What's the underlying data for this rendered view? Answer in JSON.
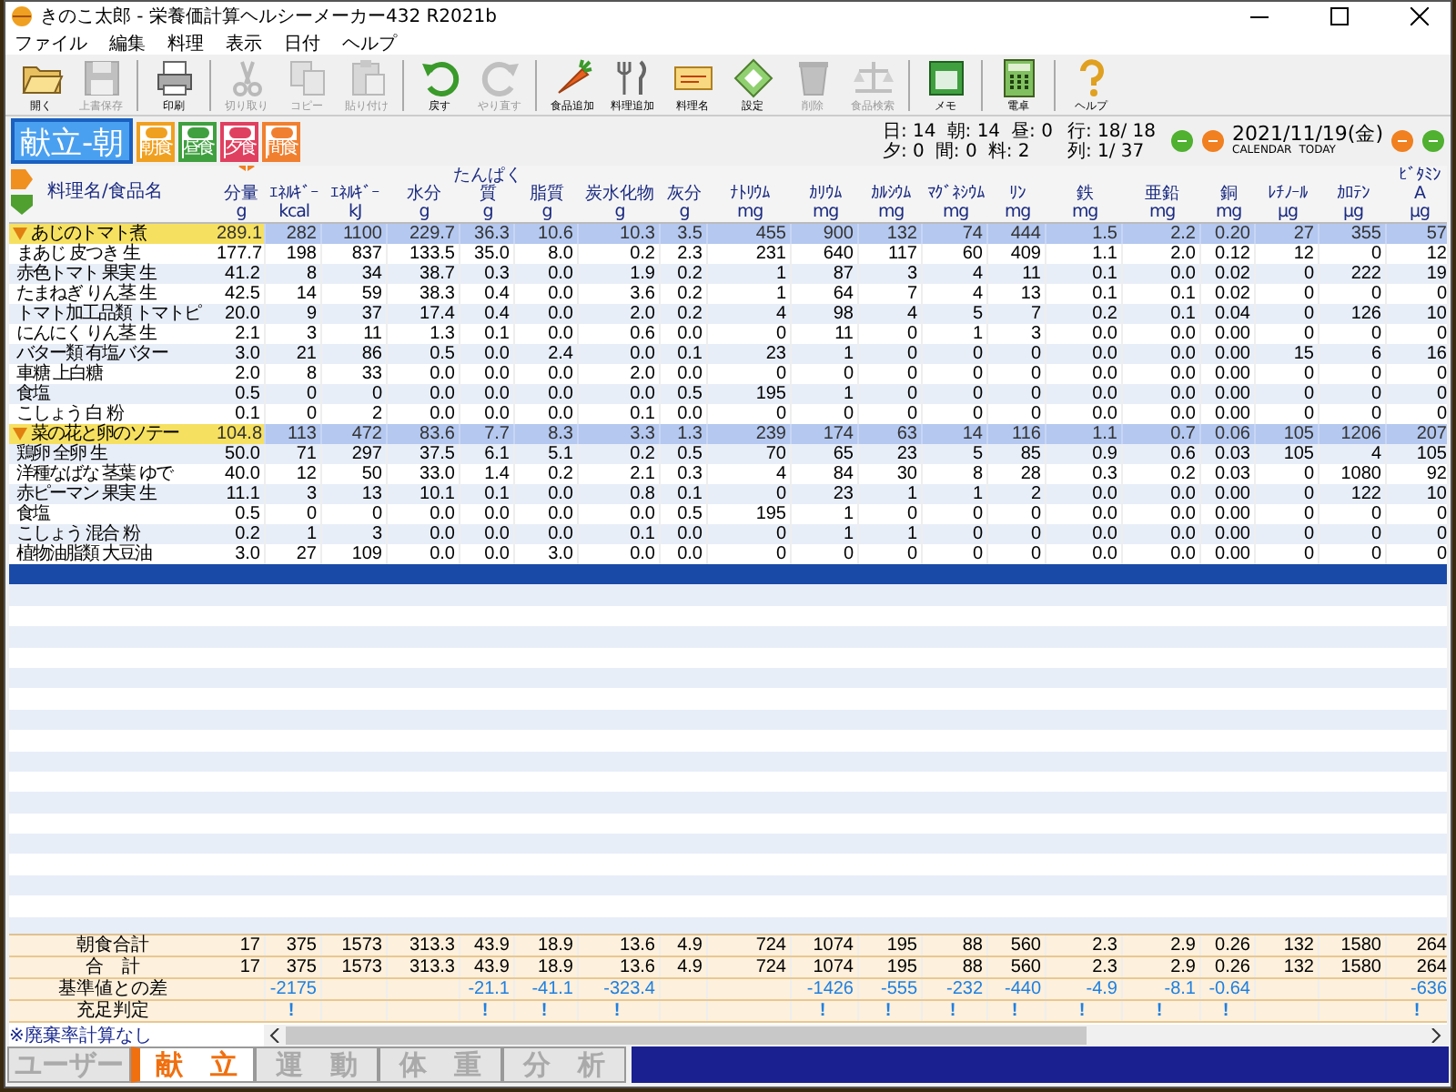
{
  "window": {
    "title": "きのこ太郎 - 栄養価計算ヘルシーメーカー432 R2021b"
  },
  "menu": [
    "ファイル",
    "編集",
    "料理",
    "表示",
    "日付",
    "ヘルプ"
  ],
  "toolbar": [
    [
      {
        "kind": "open",
        "label": "開く",
        "disabled": false
      },
      {
        "kind": "save",
        "label": "上書保存",
        "disabled": true
      }
    ],
    [
      {
        "kind": "print",
        "label": "印刷",
        "disabled": false
      }
    ],
    [
      {
        "kind": "cut",
        "label": "切り取り",
        "disabled": true
      },
      {
        "kind": "copy",
        "label": "コピー",
        "disabled": true
      },
      {
        "kind": "paste",
        "label": "貼り付け",
        "disabled": true
      }
    ],
    [
      {
        "kind": "undo",
        "label": "戻す",
        "disabled": false
      },
      {
        "kind": "redo",
        "label": "やり直す",
        "disabled": true
      }
    ],
    [
      {
        "kind": "food",
        "label": "食品追加",
        "disabled": false
      },
      {
        "kind": "dish",
        "label": "料理追加",
        "disabled": false
      },
      {
        "kind": "cook",
        "label": "料理名",
        "disabled": false
      },
      {
        "kind": "settings",
        "label": "設定",
        "disabled": false
      },
      {
        "kind": "delete",
        "label": "削除",
        "disabled": true
      },
      {
        "kind": "scale",
        "label": "食品検索",
        "disabled": true
      }
    ],
    [
      {
        "kind": "memo",
        "label": "メモ",
        "disabled": false
      }
    ],
    [
      {
        "kind": "calc",
        "label": "電卓",
        "disabled": false
      }
    ],
    [
      {
        "kind": "help",
        "label": "ヘルプ",
        "disabled": false
      }
    ]
  ],
  "meal_bar": {
    "current": "献立-朝",
    "meals": [
      {
        "label": "朝食",
        "color": "#f0a020"
      },
      {
        "label": "昼食",
        "color": "#40a040"
      },
      {
        "label": "夕食",
        "color": "#e04060"
      },
      {
        "label": "間食",
        "color": "#f08030"
      }
    ],
    "counts": [
      [
        "日: 14",
        "朝: 14",
        "昼: 0"
      ],
      [
        "夕: 0",
        "間: 0",
        "料: 2"
      ]
    ],
    "position": [
      "行: 18/ 18",
      "列: 1/ 37"
    ],
    "date": "2021/11/19(金)",
    "calendar_label": "CALENDAR",
    "today_label": "TODAY"
  },
  "table": {
    "name_header": "料理名/食品名",
    "columns": [
      [
        "分量",
        "g"
      ],
      [
        "ｴﾈﾙｷﾞｰ",
        "kcal"
      ],
      [
        "ｴﾈﾙｷﾞｰ",
        "kJ"
      ],
      [
        "水分",
        "g"
      ],
      [
        "たんぱく",
        "質",
        "g"
      ],
      [
        "脂質",
        "g"
      ],
      [
        "炭水化物",
        "g"
      ],
      [
        "灰分",
        "g"
      ],
      [
        "ﾅﾄﾘｳﾑ",
        "mg"
      ],
      [
        "ｶﾘｳﾑ",
        "mg"
      ],
      [
        "ｶﾙｼｳﾑ",
        "mg"
      ],
      [
        "ﾏｸﾞﾈｼｳﾑ",
        "mg"
      ],
      [
        "ﾘﾝ",
        "mg"
      ],
      [
        "鉄",
        "mg"
      ],
      [
        "亜鉛",
        "mg"
      ],
      [
        "銅",
        "mg"
      ],
      [
        "ﾚﾁﾉｰﾙ",
        "μg"
      ],
      [
        "ｶﾛﾃﾝ",
        "μg"
      ],
      [
        "ﾋﾞﾀﾐﾝ",
        "A",
        "μg"
      ]
    ],
    "dishes": [
      {
        "name": "あじのトマト煮",
        "expanded": true,
        "values": [
          "289.1",
          "282",
          "1100",
          "229.7",
          "36.3",
          "10.6",
          "10.3",
          "3.5",
          "455",
          "900",
          "132",
          "74",
          "444",
          "1.5",
          "2.2",
          "0.20",
          "27",
          "355",
          "57"
        ],
        "children": [
          {
            "name": "まあじ 皮つき 生",
            "values": [
              "177.7",
              "198",
              "837",
              "133.5",
              "35.0",
              "8.0",
              "0.2",
              "2.3",
              "231",
              "640",
              "117",
              "60",
              "409",
              "1.1",
              "2.0",
              "0.12",
              "12",
              "0",
              "12"
            ]
          },
          {
            "name": "赤色トマト 果実 生",
            "values": [
              "41.2",
              "8",
              "34",
              "38.7",
              "0.3",
              "0.0",
              "1.9",
              "0.2",
              "1",
              "87",
              "3",
              "4",
              "11",
              "0.1",
              "0.0",
              "0.02",
              "0",
              "222",
              "19"
            ]
          },
          {
            "name": "たまねぎ りん茎 生",
            "values": [
              "42.5",
              "14",
              "59",
              "38.3",
              "0.4",
              "0.0",
              "3.6",
              "0.2",
              "1",
              "64",
              "7",
              "4",
              "13",
              "0.1",
              "0.1",
              "0.02",
              "0",
              "0",
              "0"
            ]
          },
          {
            "name": "トマト加工品類 トマトピ",
            "values": [
              "20.0",
              "9",
              "37",
              "17.4",
              "0.4",
              "0.0",
              "2.0",
              "0.2",
              "4",
              "98",
              "4",
              "5",
              "7",
              "0.2",
              "0.1",
              "0.04",
              "0",
              "126",
              "10"
            ]
          },
          {
            "name": "にんにく りん茎 生",
            "values": [
              "2.1",
              "3",
              "11",
              "1.3",
              "0.1",
              "0.0",
              "0.6",
              "0.0",
              "0",
              "11",
              "0",
              "1",
              "3",
              "0.0",
              "0.0",
              "0.00",
              "0",
              "0",
              "0"
            ]
          },
          {
            "name": "バター類 有塩バター",
            "values": [
              "3.0",
              "21",
              "86",
              "0.5",
              "0.0",
              "2.4",
              "0.0",
              "0.1",
              "23",
              "1",
              "0",
              "0",
              "0",
              "0.0",
              "0.0",
              "0.00",
              "15",
              "6",
              "16"
            ]
          },
          {
            "name": "車糖 上白糖",
            "values": [
              "2.0",
              "8",
              "33",
              "0.0",
              "0.0",
              "0.0",
              "2.0",
              "0.0",
              "0",
              "0",
              "0",
              "0",
              "0",
              "0.0",
              "0.0",
              "0.00",
              "0",
              "0",
              "0"
            ]
          },
          {
            "name": "食塩",
            "values": [
              "0.5",
              "0",
              "0",
              "0.0",
              "0.0",
              "0.0",
              "0.0",
              "0.5",
              "195",
              "1",
              "0",
              "0",
              "0",
              "0.0",
              "0.0",
              "0.00",
              "0",
              "0",
              "0"
            ]
          },
          {
            "name": "こしょう 白 粉",
            "values": [
              "0.1",
              "0",
              "2",
              "0.0",
              "0.0",
              "0.0",
              "0.1",
              "0.0",
              "0",
              "0",
              "0",
              "0",
              "0",
              "0.0",
              "0.0",
              "0.00",
              "0",
              "0",
              "0"
            ]
          }
        ]
      },
      {
        "name": "菜の花と卵のソテー",
        "expanded": true,
        "values": [
          "104.8",
          "113",
          "472",
          "83.6",
          "7.7",
          "8.3",
          "3.3",
          "1.3",
          "239",
          "174",
          "63",
          "14",
          "116",
          "1.1",
          "0.7",
          "0.06",
          "105",
          "1206",
          "207"
        ],
        "children": [
          {
            "name": "鶏卵 全卵 生",
            "values": [
              "50.0",
              "71",
              "297",
              "37.5",
              "6.1",
              "5.1",
              "0.2",
              "0.5",
              "70",
              "65",
              "23",
              "5",
              "85",
              "0.9",
              "0.6",
              "0.03",
              "105",
              "4",
              "105"
            ]
          },
          {
            "name": "洋種なばな 茎葉 ゆで",
            "values": [
              "40.0",
              "12",
              "50",
              "33.0",
              "1.4",
              "0.2",
              "2.1",
              "0.3",
              "4",
              "84",
              "30",
              "8",
              "28",
              "0.3",
              "0.2",
              "0.03",
              "0",
              "1080",
              "92"
            ]
          },
          {
            "name": "赤ピーマン 果実 生",
            "values": [
              "11.1",
              "3",
              "13",
              "10.1",
              "0.1",
              "0.0",
              "0.8",
              "0.1",
              "0",
              "23",
              "1",
              "1",
              "2",
              "0.0",
              "0.0",
              "0.00",
              "0",
              "122",
              "10"
            ]
          },
          {
            "name": "食塩",
            "values": [
              "0.5",
              "0",
              "0",
              "0.0",
              "0.0",
              "0.0",
              "0.0",
              "0.5",
              "195",
              "1",
              "0",
              "0",
              "0",
              "0.0",
              "0.0",
              "0.00",
              "0",
              "0",
              "0"
            ]
          },
          {
            "name": "こしょう 混合 粉",
            "values": [
              "0.2",
              "1",
              "3",
              "0.0",
              "0.0",
              "0.0",
              "0.1",
              "0.0",
              "0",
              "1",
              "1",
              "0",
              "0",
              "0.0",
              "0.0",
              "0.00",
              "0",
              "0",
              "0"
            ]
          },
          {
            "name": "植物油脂類 大豆油",
            "values": [
              "3.0",
              "27",
              "109",
              "0.0",
              "0.0",
              "3.0",
              "0.0",
              "0.0",
              "0",
              "0",
              "0",
              "0",
              "0",
              "0.0",
              "0.0",
              "0.00",
              "0",
              "0",
              "0"
            ]
          }
        ]
      }
    ],
    "blank_rows": [
      {
        "selected": true
      }
    ],
    "summary": [
      {
        "kind": "total",
        "label": "朝食合計",
        "values": [
          "17",
          "375",
          "1573",
          "313.3",
          "43.9",
          "18.9",
          "13.6",
          "4.9",
          "724",
          "1074",
          "195",
          "88",
          "560",
          "2.3",
          "2.9",
          "0.26",
          "132",
          "1580",
          "264"
        ]
      },
      {
        "kind": "total",
        "label": "合　計",
        "values": [
          "17",
          "375",
          "1573",
          "313.3",
          "43.9",
          "18.9",
          "13.6",
          "4.9",
          "724",
          "1074",
          "195",
          "88",
          "560",
          "2.3",
          "2.9",
          "0.26",
          "132",
          "1580",
          "264"
        ]
      },
      {
        "kind": "diff",
        "label": "基準値との差",
        "values": {
          "1": "-2175",
          "4": "-21.1",
          "5": "-41.1",
          "6": "-323.4",
          "9": "-1426",
          "10": "-555",
          "11": "-232",
          "12": "-440",
          "13": "-4.9",
          "14": "-8.1",
          "15": "-0.64",
          "18": "-636"
        }
      },
      {
        "kind": "judge",
        "label": "充足判定",
        "values": {
          "1": "!",
          "4": "!",
          "5": "!",
          "6": "!",
          "9": "!",
          "10": "!",
          "11": "!",
          "12": "!",
          "13": "!",
          "14": "!",
          "15": "!",
          "18": "!"
        }
      }
    ]
  },
  "note": "※廃棄率計算なし",
  "tabs": [
    {
      "label": "ユーザー",
      "selected": false
    },
    {
      "label": "献　立",
      "selected": true
    },
    {
      "label": "運　動",
      "selected": false
    },
    {
      "label": "体　重",
      "selected": false
    },
    {
      "label": "分　析",
      "selected": false
    }
  ]
}
